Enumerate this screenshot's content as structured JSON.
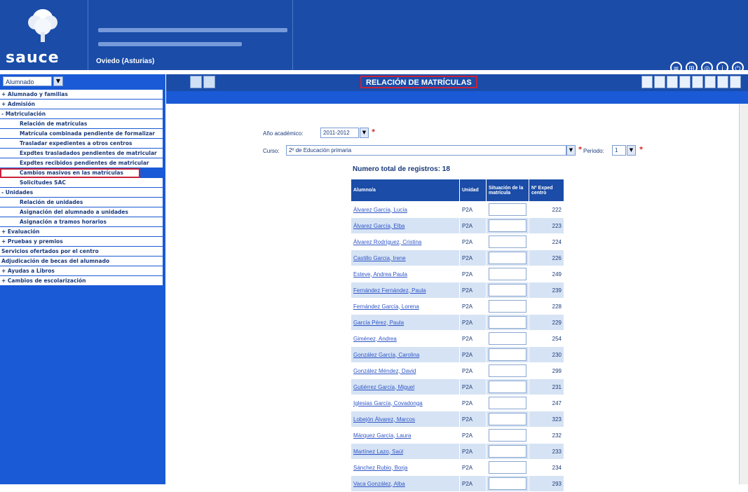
{
  "header": {
    "logo_text": "sauce",
    "location": "Oviedo (Asturias)",
    "icons": [
      "print-icon",
      "printer-icon",
      "settings-icon",
      "info-icon",
      "exit-icon"
    ]
  },
  "toolbar": {
    "title": "RELACIÓN DE MATRÍCULAS"
  },
  "sidebar": {
    "role": "Alumnado",
    "items": [
      {
        "label": "+ Alumnado y familias",
        "kind": "top"
      },
      {
        "label": "+ Admisión",
        "kind": "top"
      },
      {
        "label": "- Matriculación",
        "kind": "top"
      },
      {
        "label": "Relación de matrículas",
        "kind": "sub"
      },
      {
        "label": "Matrícula combinada pendiente de formalizar",
        "kind": "sub"
      },
      {
        "label": "Trasladar expedientes a otros centros",
        "kind": "sub"
      },
      {
        "label": "Expdtes trasladados pendientes de matricular",
        "kind": "sub"
      },
      {
        "label": "Expdtes recibidos pendientes de matricular",
        "kind": "sub"
      },
      {
        "label": "Cambios masivos en las matrículas",
        "kind": "sub-highlight"
      },
      {
        "label": "Solicitudes SAC",
        "kind": "sub"
      },
      {
        "label": "- Unidades",
        "kind": "top"
      },
      {
        "label": "Relación de unidades",
        "kind": "sub"
      },
      {
        "label": "Asignación del alumnado a unidades",
        "kind": "sub"
      },
      {
        "label": "Asignación a tramos horarios",
        "kind": "sub"
      },
      {
        "label": "+ Evaluación",
        "kind": "top"
      },
      {
        "label": "+ Pruebas y premios",
        "kind": "top"
      },
      {
        "label": "Servicios ofertados por el centro",
        "kind": "top"
      },
      {
        "label": "Adjudicación de becas del alumnado",
        "kind": "top"
      },
      {
        "label": "+ Ayudas a Libros",
        "kind": "top"
      },
      {
        "label": "+ Cambios de escolarización",
        "kind": "top"
      }
    ]
  },
  "filters": {
    "year_label": "Año académico:",
    "year_value": "2011-2012",
    "course_label": "Curso:",
    "course_value": "2º de Educación primaria",
    "period_label": "Periodo:",
    "period_value": "1"
  },
  "results": {
    "total_label": "Numero total de registros: 18",
    "headers": [
      "Alumno/a",
      "Unidad",
      "Situación de la matrícula",
      "Nº Exped centro"
    ],
    "rows": [
      {
        "name": "Álvarez García, Lucía",
        "unit": "P2A",
        "num": "222"
      },
      {
        "name": "Álvarez García, Elba",
        "unit": "P2A",
        "num": "223"
      },
      {
        "name": "Álvarez Rodríguez, Cristina",
        "unit": "P2A",
        "num": "224"
      },
      {
        "name": "Castillo Garcia, Irene",
        "unit": "P2A",
        "num": "226"
      },
      {
        "name": "Esteve, Andrea Paula",
        "unit": "P2A",
        "num": "249"
      },
      {
        "name": "Fernández Fernández, Paula",
        "unit": "P2A",
        "num": "239"
      },
      {
        "name": "Fernández García, Lorena",
        "unit": "P2A",
        "num": "228"
      },
      {
        "name": "García Pérez, Paula",
        "unit": "P2A",
        "num": "229"
      },
      {
        "name": "Giménez, Andrea",
        "unit": "P2A",
        "num": "254"
      },
      {
        "name": "González García, Carolina",
        "unit": "P2A",
        "num": "230"
      },
      {
        "name": "González Méndez, David",
        "unit": "P2A",
        "num": "299"
      },
      {
        "name": "Gutiérrez García, Miguel",
        "unit": "P2A",
        "num": "231"
      },
      {
        "name": "Iglesias García, Covadonga",
        "unit": "P2A",
        "num": "247"
      },
      {
        "name": "Lobejón Álvarez, Marcos",
        "unit": "P2A",
        "num": "323"
      },
      {
        "name": "Márquez García, Laura",
        "unit": "P2A",
        "num": "232"
      },
      {
        "name": "Martínez Lazo, Saúl",
        "unit": "P2A",
        "num": "233"
      },
      {
        "name": "Sánchez Rubio, Borja",
        "unit": "P2A",
        "num": "234"
      },
      {
        "name": "Vaca González, Alba",
        "unit": "P2A",
        "num": "293"
      }
    ]
  }
}
